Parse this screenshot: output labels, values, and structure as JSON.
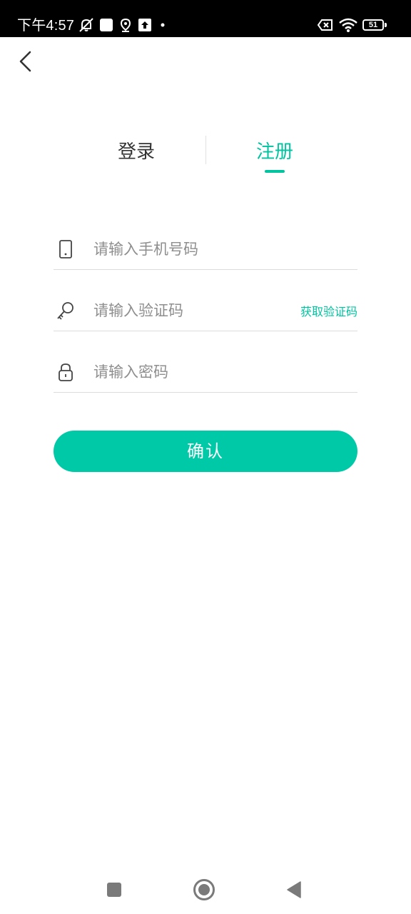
{
  "status_bar": {
    "time": "下午4:57",
    "battery_level": "51",
    "icons": [
      "silent-bell-icon",
      "app-square-icon",
      "location-icon",
      "upload-icon",
      "dot-icon",
      "no-sim-icon",
      "wifi-icon",
      "battery-icon"
    ]
  },
  "nav": {
    "back_icon": "chevron-left-icon"
  },
  "tabs": [
    {
      "label": "登录",
      "active": false
    },
    {
      "label": "注册",
      "active": true
    }
  ],
  "form": {
    "phone": {
      "placeholder": "请输入手机号码",
      "value": "",
      "icon": "phone-icon"
    },
    "code": {
      "placeholder": "请输入验证码",
      "value": "",
      "icon": "key-icon",
      "action_label": "获取验证码"
    },
    "password": {
      "placeholder": "请输入密码",
      "value": "",
      "icon": "lock-icon"
    },
    "confirm_label": "确认"
  },
  "system_nav": [
    "recents-square-icon",
    "home-circle-icon",
    "back-triangle-icon"
  ],
  "colors": {
    "accent": "#00c4a0",
    "button": "#00c9a7",
    "text": "#333333",
    "placeholder": "#8e8e8e",
    "status_bar": "#000000"
  }
}
